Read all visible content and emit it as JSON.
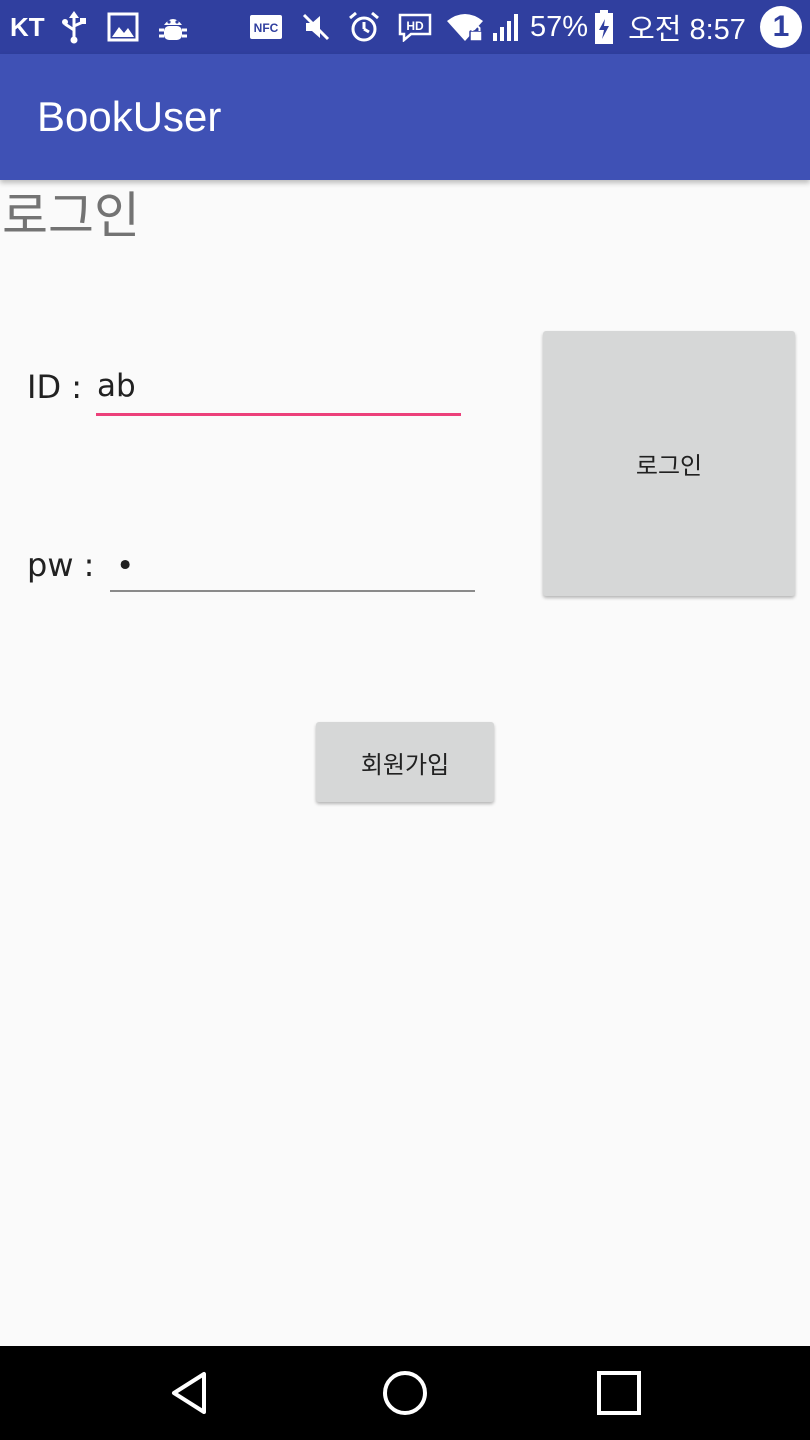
{
  "status_bar": {
    "carrier": "KT",
    "battery": "57%",
    "time": "오전 8:57",
    "notification_count": "1",
    "icons": [
      "usb-icon",
      "image-icon",
      "android-debug-icon",
      "nfc-icon",
      "mute-icon",
      "alarm-icon",
      "hd-voice-icon",
      "wifi-icon",
      "signal-icon",
      "battery-icon"
    ]
  },
  "app_bar": {
    "title": "BookUser"
  },
  "page": {
    "heading": "로그인"
  },
  "form": {
    "id_label": "ID :",
    "id_value": "ab",
    "pw_label": "pw :",
    "pw_value": "•",
    "login_button": "로그인",
    "signup_button": "회원가입"
  },
  "nav": {
    "icons": [
      "back-icon",
      "home-icon",
      "recents-icon"
    ]
  },
  "colors": {
    "status_bar": "#303f9f",
    "app_bar": "#3f51b5",
    "accent": "#ec407a",
    "background": "#fafafa",
    "button": "#d6d7d7"
  }
}
